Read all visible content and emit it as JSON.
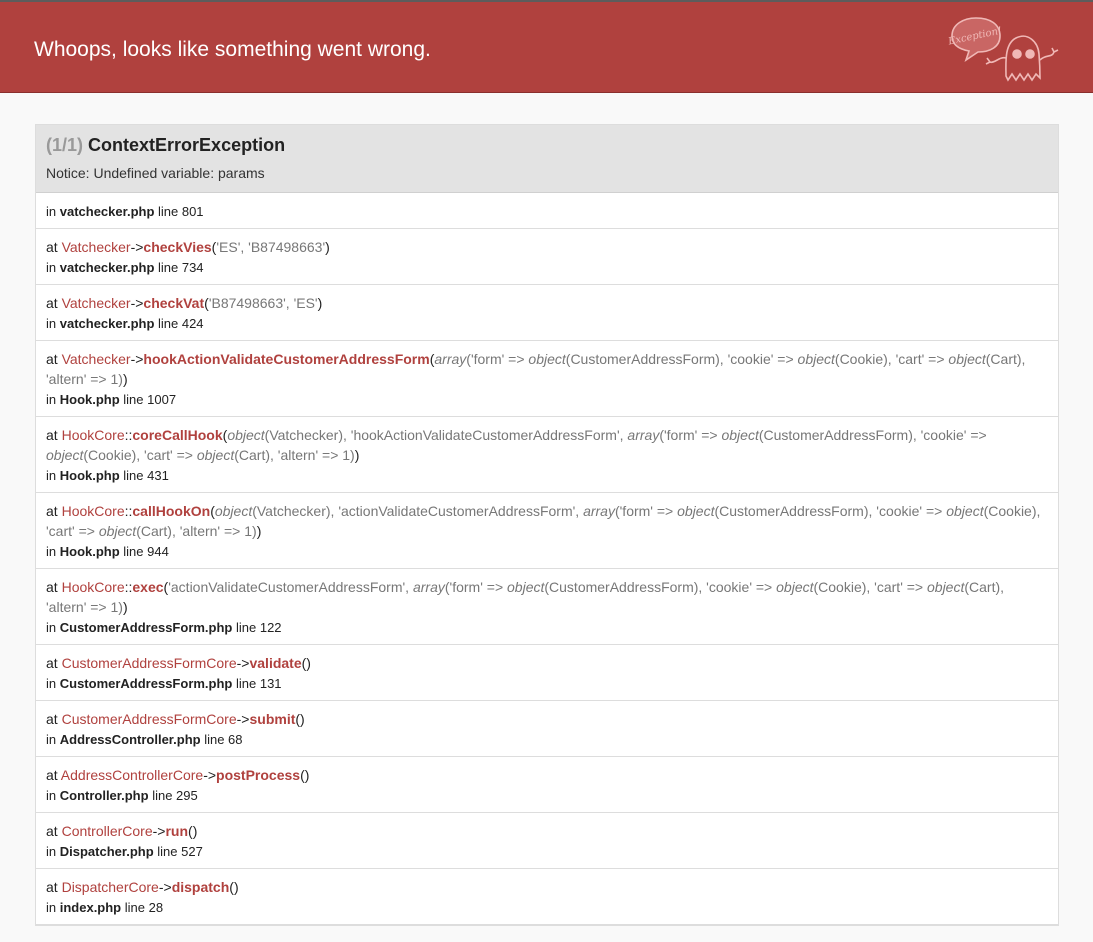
{
  "header": {
    "title": "Whoops, looks like something went wrong.",
    "logo_text": "Exception!",
    "colors": {
      "bar": "#b0413e",
      "accent": "#b0413e"
    }
  },
  "exception": {
    "count": "(1/1)",
    "class": "ContextErrorException",
    "message": "Notice: Undefined variable: params"
  },
  "trace": [
    {
      "cls": "",
      "sep": "",
      "fn": "",
      "args": [],
      "file": "vatchecker.php",
      "line": "801"
    },
    {
      "cls": "Vatchecker",
      "sep": "->",
      "fn": "checkVies",
      "args": [
        {
          "t": "'ES', 'B87498663'",
          "k": "s"
        }
      ],
      "file": "vatchecker.php",
      "line": "734"
    },
    {
      "cls": "Vatchecker",
      "sep": "->",
      "fn": "checkVat",
      "args": [
        {
          "t": "'B87498663', 'ES'",
          "k": "s"
        }
      ],
      "file": "vatchecker.php",
      "line": "424"
    },
    {
      "cls": "Vatchecker",
      "sep": "->",
      "fn": "hookActionValidateCustomerAddressForm",
      "args": [
        {
          "t": "array",
          "k": "i"
        },
        {
          "t": "('form' => ",
          "k": "s"
        },
        {
          "t": "object",
          "k": "i"
        },
        {
          "t": "(CustomerAddressForm), 'cookie' => ",
          "k": "s"
        },
        {
          "t": "object",
          "k": "i"
        },
        {
          "t": "(Cookie), 'cart' => ",
          "k": "s"
        },
        {
          "t": "object",
          "k": "i"
        },
        {
          "t": "(Cart), 'altern' => 1)",
          "k": "s"
        }
      ],
      "file": "Hook.php",
      "line": "1007"
    },
    {
      "cls": "HookCore",
      "sep": "::",
      "fn": "coreCallHook",
      "args": [
        {
          "t": "object",
          "k": "i"
        },
        {
          "t": "(Vatchecker), 'hookActionValidateCustomerAddressForm', ",
          "k": "s"
        },
        {
          "t": "array",
          "k": "i"
        },
        {
          "t": "('form' => ",
          "k": "s"
        },
        {
          "t": "object",
          "k": "i"
        },
        {
          "t": "(CustomerAddressForm), 'cookie' => ",
          "k": "s"
        },
        {
          "t": "object",
          "k": "i"
        },
        {
          "t": "(Cookie), 'cart' => ",
          "k": "s"
        },
        {
          "t": "object",
          "k": "i"
        },
        {
          "t": "(Cart), 'altern' => 1)",
          "k": "s"
        }
      ],
      "file": "Hook.php",
      "line": "431"
    },
    {
      "cls": "HookCore",
      "sep": "::",
      "fn": "callHookOn",
      "args": [
        {
          "t": "object",
          "k": "i"
        },
        {
          "t": "(Vatchecker), 'actionValidateCustomerAddressForm', ",
          "k": "s"
        },
        {
          "t": "array",
          "k": "i"
        },
        {
          "t": "('form' => ",
          "k": "s"
        },
        {
          "t": "object",
          "k": "i"
        },
        {
          "t": "(CustomerAddressForm), 'cookie' => ",
          "k": "s"
        },
        {
          "t": "object",
          "k": "i"
        },
        {
          "t": "(Cookie), 'cart' => ",
          "k": "s"
        },
        {
          "t": "object",
          "k": "i"
        },
        {
          "t": "(Cart), 'altern' => 1)",
          "k": "s"
        }
      ],
      "file": "Hook.php",
      "line": "944"
    },
    {
      "cls": "HookCore",
      "sep": "::",
      "fn": "exec",
      "args": [
        {
          "t": "'actionValidateCustomerAddressForm', ",
          "k": "s"
        },
        {
          "t": "array",
          "k": "i"
        },
        {
          "t": "('form' => ",
          "k": "s"
        },
        {
          "t": "object",
          "k": "i"
        },
        {
          "t": "(CustomerAddressForm), 'cookie' => ",
          "k": "s"
        },
        {
          "t": "object",
          "k": "i"
        },
        {
          "t": "(Cookie), 'cart' => ",
          "k": "s"
        },
        {
          "t": "object",
          "k": "i"
        },
        {
          "t": "(Cart), 'altern' => 1)",
          "k": "s"
        }
      ],
      "file": "CustomerAddressForm.php",
      "line": "122"
    },
    {
      "cls": "CustomerAddressFormCore",
      "sep": "->",
      "fn": "validate",
      "args": [],
      "file": "CustomerAddressForm.php",
      "line": "131"
    },
    {
      "cls": "CustomerAddressFormCore",
      "sep": "->",
      "fn": "submit",
      "args": [],
      "file": "AddressController.php",
      "line": "68"
    },
    {
      "cls": "AddressControllerCore",
      "sep": "->",
      "fn": "postProcess",
      "args": [],
      "file": "Controller.php",
      "line": "295"
    },
    {
      "cls": "ControllerCore",
      "sep": "->",
      "fn": "run",
      "args": [],
      "file": "Dispatcher.php",
      "line": "527"
    },
    {
      "cls": "DispatcherCore",
      "sep": "->",
      "fn": "dispatch",
      "args": [],
      "file": "index.php",
      "line": "28"
    }
  ],
  "labels": {
    "at": "at",
    "in": "in",
    "line": "line"
  }
}
